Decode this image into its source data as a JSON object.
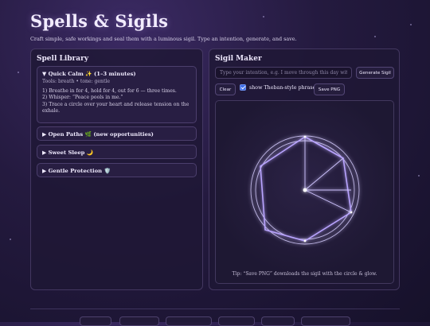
{
  "header": {
    "title": "Spells & Sigils",
    "subtitle": "Craft simple, safe workings and seal them with a luminous sigil. Type an intention, generate, and save."
  },
  "library": {
    "title": "Spell Library",
    "open_item": {
      "label": "▼ Quick Calm ✨ (1–3 minutes)",
      "meta": "Tools: breath • tone: gentle",
      "steps": [
        "1) Breathe in for 4, hold for 4, out for 6 — three times.",
        "2) Whisper: “Peace pools in me.”",
        "3) Trace a circle over your heart and release tension on the exhale."
      ]
    },
    "items": [
      {
        "label": "▶ Open Paths 🌿 (new opportunities)"
      },
      {
        "label": "▶ Sweet Sleep 🌙"
      },
      {
        "label": "▶ Gentle Protection 🛡️"
      }
    ]
  },
  "maker": {
    "title": "Sigil Maker",
    "input_placeholder": "Type your intention, e.g. I move through this day with ease",
    "generate_label": "Generate Sigil",
    "clear_label": "Clear",
    "theban_label": "show Theban-style phrase",
    "theban_checked": true,
    "save_label": "Save PNG",
    "tip": "Tip: “Save PNG” downloads the sigil with the circle & glow."
  },
  "colors": {
    "accent": "#b9a4ff",
    "checkbox": "#3f6ee8"
  }
}
